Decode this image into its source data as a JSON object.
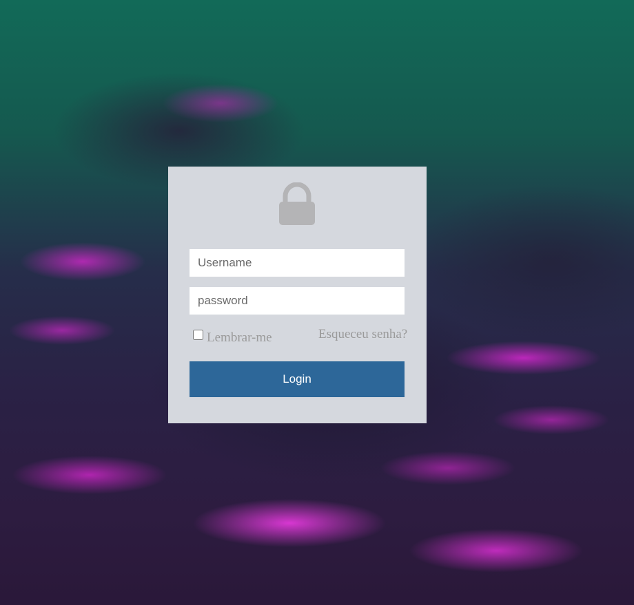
{
  "login": {
    "username": {
      "placeholder": "Username",
      "value": ""
    },
    "password": {
      "placeholder": "password",
      "value": ""
    },
    "remember_me": {
      "label": "Lembrar-me",
      "checked": false
    },
    "forgot_password": "Esqueceu senha?",
    "submit_label": "Login"
  },
  "icons": {
    "header": "lock-icon"
  },
  "colors": {
    "card_background": "#d5d8de",
    "button_background": "#2d6799",
    "button_text": "#ffffff",
    "lock_icon": "#b4b4b6",
    "muted_text": "#9a9a9a"
  }
}
